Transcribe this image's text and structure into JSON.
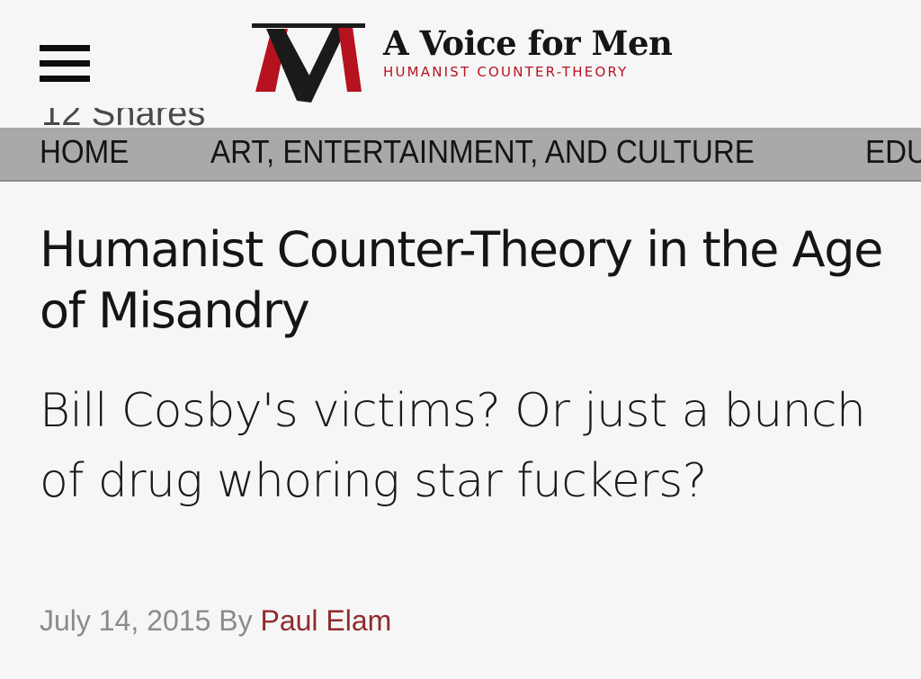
{
  "header": {
    "site_name": "A Voice for Men",
    "tagline": "HUMANIST COUNTER-THEORY",
    "menu_icon": "hamburger-menu-icon",
    "logo_icon": "avfm-logo-icon",
    "shares_text": "12 Shares"
  },
  "nav": {
    "items": [
      {
        "label": "HOME"
      },
      {
        "label": "ART, ENTERTAINMENT, AND CULTURE"
      },
      {
        "label": "EDU"
      }
    ]
  },
  "main": {
    "site_title": "Humanist Counter-Theory in the Age of Misandry",
    "article_title": "Bill Cosby's victims? Or just a bunch of drug whoring star fuckers?",
    "date": "July 14, 2015",
    "by_label": "By",
    "author": "Paul Elam"
  },
  "colors": {
    "brand_red": "#b6121f",
    "author_link": "#8f2b2e",
    "nav_background": "#a9a9a9",
    "byline_gray": "#8b8b8b"
  }
}
